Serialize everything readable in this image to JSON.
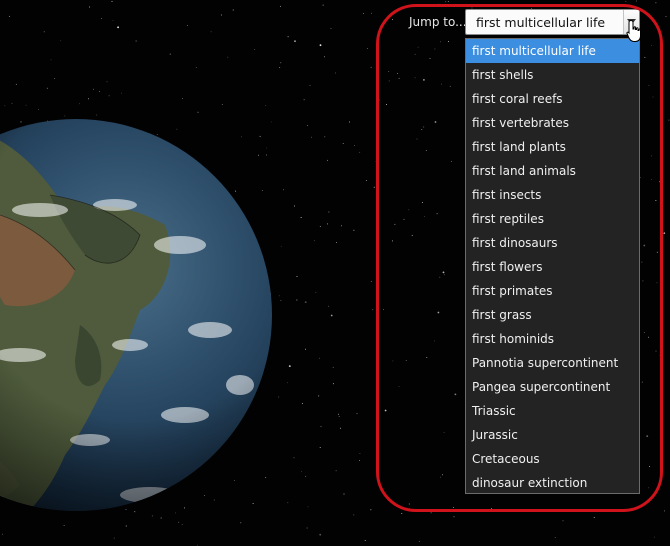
{
  "jump": {
    "label": "Jump to...",
    "selected": "first multicellular life",
    "options": [
      "first multicellular life",
      "first shells",
      "first coral reefs",
      "first vertebrates",
      "first land plants",
      "first land animals",
      "first insects",
      "first reptiles",
      "first dinosaurs",
      "first flowers",
      "first primates",
      "first grass",
      "first hominids",
      "Pannotia supercontinent",
      "Pangea supercontinent",
      "Triassic",
      "Jurassic",
      "Cretaceous",
      "dinosaur extinction"
    ]
  },
  "icons": {
    "dropdown_arrow": "chevron-down-icon",
    "cursor": "hand-pointer-icon"
  },
  "colors": {
    "highlight_ring": "#d0121b",
    "selected_option": "#3c8ee0",
    "list_background": "#232323",
    "space": "#020203"
  }
}
